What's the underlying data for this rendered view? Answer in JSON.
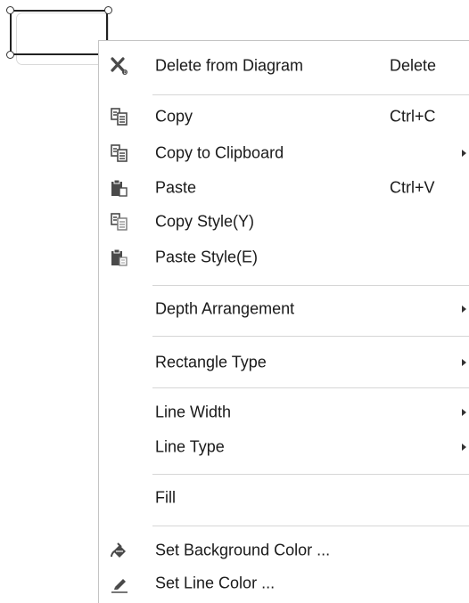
{
  "menu": {
    "items": {
      "delete": {
        "label": "Delete from Diagram",
        "shortcut": "Delete",
        "icon": "delete-x-icon"
      },
      "copy": {
        "label": "Copy",
        "shortcut": "Ctrl+C",
        "icon": "copy-icon"
      },
      "copy_clipboard": {
        "label": "Copy to Clipboard",
        "icon": "copy-clipboard-icon",
        "submenu": true
      },
      "paste": {
        "label": "Paste",
        "shortcut": "Ctrl+V",
        "icon": "paste-icon"
      },
      "copy_style": {
        "label": "Copy Style(Y)",
        "icon": "copy-style-icon"
      },
      "paste_style": {
        "label": "Paste Style(E)",
        "icon": "paste-style-icon"
      },
      "depth": {
        "label": "Depth Arrangement",
        "submenu": true
      },
      "rect_type": {
        "label": "Rectangle Type",
        "submenu": true
      },
      "line_width": {
        "label": "Line Width",
        "submenu": true
      },
      "line_type": {
        "label": "Line Type",
        "submenu": true
      },
      "fill": {
        "label": "Fill"
      },
      "bg_color": {
        "label": "Set Background Color ...",
        "icon": "paint-bucket-icon"
      },
      "line_color": {
        "label": "Set Line Color ...",
        "icon": "pen-line-icon"
      }
    }
  },
  "colors": {
    "menu_border": "#c4c4c4",
    "separator": "#d6d6d6",
    "text": "#1a1a1a",
    "icon": "#4a4a4a"
  }
}
